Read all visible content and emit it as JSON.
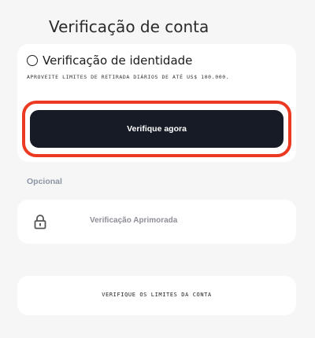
{
  "header": {
    "title": "Verificação de conta"
  },
  "identity": {
    "label": "Verificação de identidade",
    "limit_note": "APROVEITE LIMITES DE RETIRADA DIÁRIOS DE ATÉ US$ 100.000.",
    "verify_button": "Verifique agora",
    "highlight_color": "#ec3a22",
    "button_color": "#161b25"
  },
  "optional": {
    "section_label": "Opcional",
    "enhanced_label": "Verificação Aprimorada",
    "icon": "lock-icon"
  },
  "limits": {
    "button_label": "VERIFIQUE OS LIMITES DA CONTA"
  }
}
